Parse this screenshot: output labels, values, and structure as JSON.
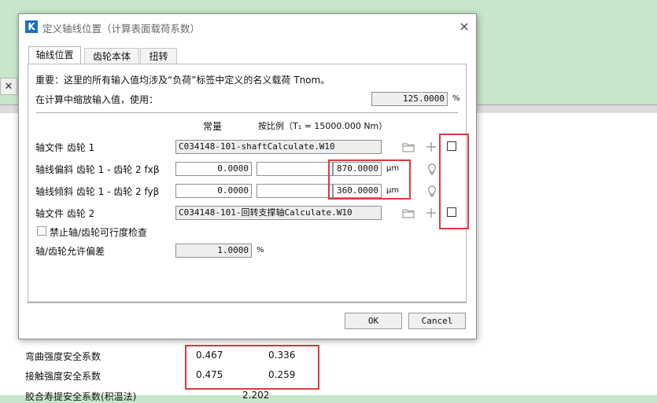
{
  "background": {
    "rows": [
      {
        "label": "弯曲强度安全系数",
        "v1": "0.467",
        "v2": "0.336"
      },
      {
        "label": "接触强度安全系数",
        "v1": "0.475",
        "v2": "0.259"
      }
    ],
    "partial_row": {
      "label": "胶合寿提安全系数(积温法)",
      "value": "2.202"
    }
  },
  "dialog": {
    "title": "定义轴线位置（计算表面载荷系数）",
    "app_icon_letter": "K",
    "close": "×",
    "tabs": [
      "轴线位置",
      "齿轮本体",
      "扭转"
    ],
    "note": "重要：这里的所有输入值均涉及“负荷”标签中定义的名义载荷 Tnom。",
    "scale_label": "在计算中缩放输入值，使用：",
    "scale_value": "125.0000",
    "scale_unit": "%",
    "col_constant": "常量",
    "col_proportional": "按比例（T₁ = 15000.000 Nm）",
    "shaft_file_1_label": "轴文件 齿轮 1",
    "shaft_file_1_value": "C034148-101-shaftCalculate.W10",
    "misalign_label": "轴线偏斜 齿轮 1 - 齿轮 2 fxβ",
    "misalign_const": "0.0000",
    "misalign_prop": "",
    "misalign_value": "870.0000",
    "misalign_unit": "μm",
    "inclin_label": "轴线倾斜 齿轮 1 - 齿轮 2 fyβ",
    "inclin_const": "0.0000",
    "inclin_prop": "",
    "inclin_value": "360.0000",
    "inclin_unit": "μm",
    "shaft_file_2_label": "轴文件 齿轮 2",
    "shaft_file_2_value": "C034148-101-回转支撑轴Calculate.W10",
    "disable_check_label": "禁止轴/齿轮可行度检查",
    "tolerance_label": "轴/齿轮允许偏差",
    "tolerance_value": "1.0000",
    "tolerance_unit": "%",
    "ok_label": "OK",
    "cancel_label": "Cancel"
  },
  "colors": {
    "accent_red": "#e0393e",
    "logo_blue": "#1f6fbf",
    "app_bg_green": "#c8e7ca"
  }
}
